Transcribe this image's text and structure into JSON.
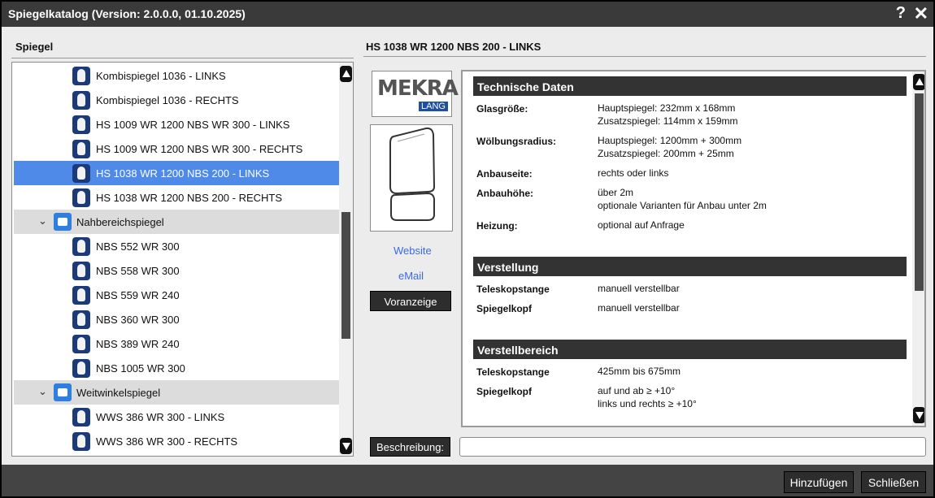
{
  "window": {
    "title": "Spiegelkatalog (Version: 2.0.0.0, 01.10.2025)",
    "help_label": "?",
    "close_label": "✕"
  },
  "left": {
    "header": "Spiegel",
    "tree": [
      {
        "label": "Kombispiegel 1036 - LINKS",
        "type": "item"
      },
      {
        "label": "Kombispiegel 1036 -  RECHTS",
        "type": "item"
      },
      {
        "label": "HS 1009 WR 1200 NBS WR 300 - LINKS",
        "type": "item"
      },
      {
        "label": "HS 1009 WR 1200 NBS WR 300 - RECHTS",
        "type": "item"
      },
      {
        "label": "HS 1038 WR 1200 NBS 200 - LINKS",
        "type": "item",
        "selected": true
      },
      {
        "label": "HS 1038 WR 1200 NBS 200 - RECHTS",
        "type": "item"
      },
      {
        "label": "Nahbereichspiegel",
        "type": "group"
      },
      {
        "label": "NBS 552 WR 300",
        "type": "item"
      },
      {
        "label": "NBS 558 WR 300",
        "type": "item"
      },
      {
        "label": "NBS 559 WR 240",
        "type": "item"
      },
      {
        "label": "NBS 360 WR 300",
        "type": "item"
      },
      {
        "label": "NBS 389 WR 240",
        "type": "item"
      },
      {
        "label": "NBS 1005 WR 300",
        "type": "item"
      },
      {
        "label": "Weitwinkelspiegel",
        "type": "group"
      },
      {
        "label": "WWS 386 WR 300 - LINKS",
        "type": "item"
      },
      {
        "label": "WWS 386 WR 300 - RECHTS",
        "type": "item"
      }
    ]
  },
  "right": {
    "title": "HS 1038 WR 1200 NBS 200 - LINKS",
    "logo_main": "MEKRA",
    "logo_sub": "LANG",
    "website_label": "Website",
    "email_label": "eMail",
    "preview_button": "Voranzeige",
    "description_label": "Beschreibung:",
    "description_value": "",
    "sections": {
      "tech": {
        "title": "Technische Daten",
        "rows": [
          {
            "key": "Glasgröße:",
            "lines": [
              "Hauptspiegel: 232mm x 168mm",
              "Zusatzspiegel: 114mm x 159mm"
            ]
          },
          {
            "key": "Wölbungsradius:",
            "lines": [
              "Hauptspiegel: 1200mm + 300mm",
              "Zusatzspiegel: 200mm + 25mm"
            ]
          },
          {
            "key": "Anbauseite:",
            "lines": [
              "rechts oder links"
            ]
          },
          {
            "key": "Anbauhöhe:",
            "lines": [
              "über 2m",
              "optionale Varianten für Anbau unter 2m"
            ]
          },
          {
            "key": "Heizung:",
            "lines": [
              "optional auf Anfrage"
            ]
          }
        ]
      },
      "verstellung": {
        "title": "Verstellung",
        "rows": [
          {
            "key": "Teleskopstange",
            "lines": [
              "manuell verstellbar"
            ]
          },
          {
            "key": "Spiegelkopf",
            "lines": [
              "manuell verstellbar"
            ]
          }
        ]
      },
      "bereich": {
        "title": "Verstellbereich",
        "rows": [
          {
            "key": "Teleskopstange",
            "lines": [
              "425mm bis 675mm"
            ]
          },
          {
            "key": "Spiegelkopf",
            "lines": [
              "auf und ab ≥ +10°",
              "links und rechts ≥ +10°"
            ]
          }
        ]
      }
    }
  },
  "footer": {
    "add_button": "Hinzufügen",
    "close_button": "Schließen"
  },
  "colors": {
    "selection": "#4f8ae9",
    "titlebar": "#3a3a3a",
    "link": "#3b6be0",
    "section_header": "#333333"
  }
}
